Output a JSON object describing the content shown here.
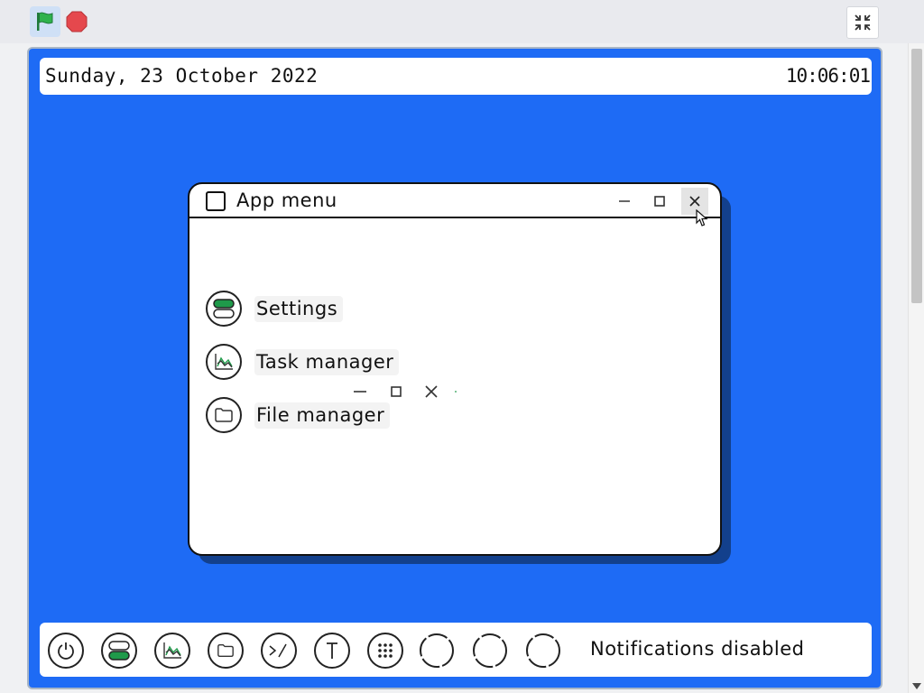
{
  "header": {
    "date": "Sunday, 23 October 2022",
    "time": "10:06:01"
  },
  "window": {
    "title": "App menu",
    "items": [
      {
        "label": "Settings",
        "icon": "settings-toggle-icon"
      },
      {
        "label": "Task manager",
        "icon": "chart-icon"
      },
      {
        "label": "File manager",
        "icon": "folder-icon"
      }
    ]
  },
  "taskbar": {
    "notifications": "Notifications disabled",
    "icons": [
      "power-icon",
      "settings-toggle-icon",
      "chart-icon",
      "folder-icon",
      "terminal-icon",
      "text-icon",
      "apps-grid-icon",
      "loading-icon",
      "loading-icon",
      "loading-icon"
    ]
  },
  "colors": {
    "desktop": "#1e6bf5",
    "accent_green": "#1f9a4a",
    "stop_red": "#e5484d"
  }
}
